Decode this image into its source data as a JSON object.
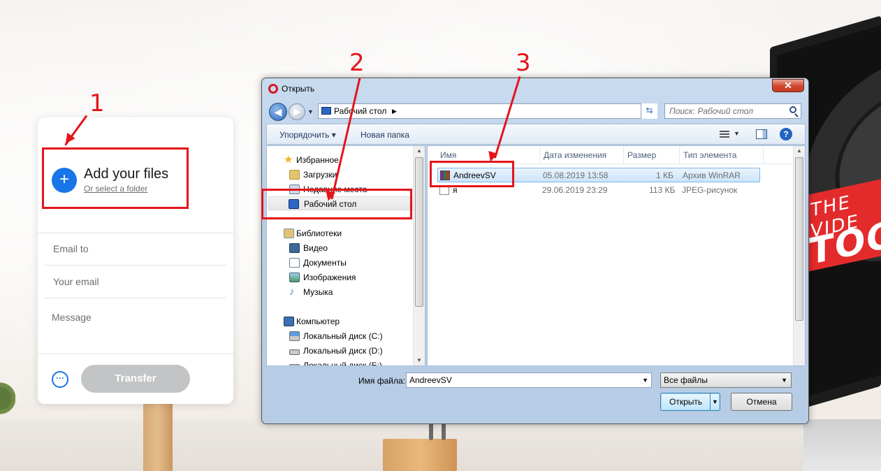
{
  "wetransfer": {
    "add_title": "Add your files",
    "add_sub": "Or select a folder",
    "plus": "+",
    "email_to_placeholder": "Email to",
    "your_email_placeholder": "Your email",
    "message_placeholder": "Message",
    "more_icon": "···",
    "transfer_label": "Transfer"
  },
  "annotations": {
    "n1": "1",
    "n2": "2",
    "n3": "3"
  },
  "dialog": {
    "title": "Открыть",
    "close": "✕",
    "address": "Рабочий стол",
    "search_placeholder": "Поиск: Рабочий стол",
    "toolbar": {
      "organize": "Упорядочить ▾",
      "new_folder": "Новая папка",
      "help": "?"
    },
    "nav": {
      "favorites": "Избранное",
      "downloads": "Загрузки",
      "recent": "Недавние места",
      "desktop": "Рабочий стол",
      "libraries": "Библиотеки",
      "video": "Видео",
      "documents": "Документы",
      "images": "Изображения",
      "music": "Музыка",
      "computer": "Компьютер",
      "disk_c": "Локальный диск (C:)",
      "disk_d": "Локальный диск (D:)",
      "disk_e": "Локальный диск (E:)"
    },
    "columns": {
      "name": "Имя",
      "date": "Дата изменения",
      "size": "Размер",
      "type": "Тип элемента"
    },
    "files": [
      {
        "name": "AndreevSV",
        "date": "05.08.2019 13:58",
        "size": "1 КБ",
        "type": "Архив WinRAR"
      },
      {
        "name": "я",
        "date": "29.06.2019 23:29",
        "size": "113 КБ",
        "type": "JPEG-рисунок"
      }
    ],
    "filename_label": "Имя файла:",
    "filename_value": "AndreevSV",
    "filetype_value": "Все файлы",
    "open_label": "Открыть",
    "cancel_label": "Отмена"
  },
  "background": {
    "banner_line1": "THE VIDE",
    "banner_line2": "TOO"
  },
  "colors": {
    "accent": "#1875e8",
    "annotation": "#e5141b",
    "transfer_disabled": "#c2c4c6"
  }
}
